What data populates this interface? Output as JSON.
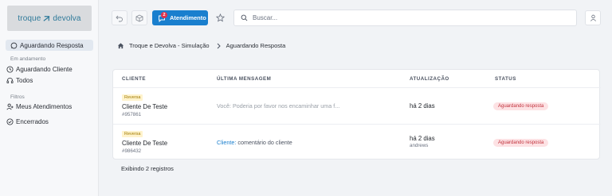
{
  "logo": {
    "text_left": "troque",
    "text_right": "devolva",
    "tagline": ""
  },
  "sidebar": {
    "active_item": "Aguardando Resposta",
    "section_in_progress": "Em andamento",
    "items_in_progress": [
      "Aguardando Cliente",
      "Todos"
    ],
    "section_filters": "Filtros",
    "items_filters": [
      "Meus Atendimentos"
    ],
    "closed": "Encerrados"
  },
  "topbar": {
    "atendimento_label": "Atendimento",
    "atendimento_badge": "2",
    "search_placeholder": "Buscar..."
  },
  "breadcrumb": {
    "root": "Troque e Devolva - Simulação",
    "current": "Aguardando Resposta"
  },
  "table": {
    "columns": [
      "CLIENTE",
      "ÚLTIMA MENSAGEM",
      "ATUALIZAÇÃO",
      "STATUS"
    ],
    "rows": [
      {
        "tag": "Reversa",
        "client": "Cliente De Teste",
        "id": "#957861",
        "message_sender": "",
        "message": "Você: Poderia por favor nos encaminhar uma f...",
        "updated": "há 2 dias",
        "updated_by": "",
        "status": "Aguardando resposta"
      },
      {
        "tag": "Reversa",
        "client": "Cliente De Teste",
        "id": "#986432",
        "message_sender": "Cliente:",
        "message": "comentário do cliente",
        "updated": "há 2 dias",
        "updated_by": "andrews",
        "status": "Aguardando resposta"
      }
    ]
  },
  "footer": "Exibindo 2 registros",
  "colors": {
    "primary": "#1a7fce",
    "badge": "#e0304a",
    "status_bg": "#fde2e4",
    "status_text": "#c0303b",
    "tag_bg": "#fff3cc"
  }
}
